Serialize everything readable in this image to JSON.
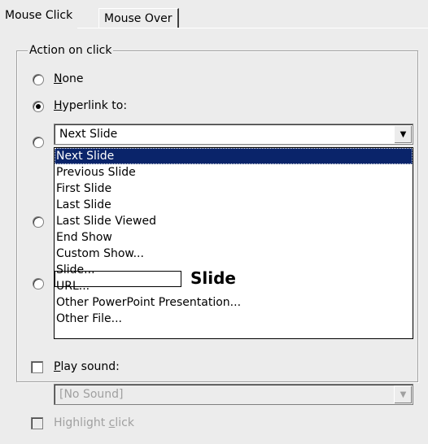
{
  "tabs": [
    {
      "label": "Mouse Click",
      "active": true
    },
    {
      "label": "Mouse Over",
      "active": false
    }
  ],
  "action_group": {
    "title": "Action on click",
    "options": {
      "none": {
        "label": "None",
        "mnemonic": "N",
        "selected": false
      },
      "hyperlink": {
        "label": "Hyperlink to:",
        "mnemonic": "H",
        "selected": true
      }
    },
    "hyperlink_value": "Next Slide"
  },
  "dropdown": {
    "items": [
      "Next Slide",
      "Previous Slide",
      "First Slide",
      "Last Slide",
      "Last Slide Viewed",
      "End Show",
      "Custom Show...",
      "Slide...",
      "URL...",
      "Other PowerPoint Presentation...",
      "Other File..."
    ],
    "selected_index": 0
  },
  "annotation": {
    "label": "Slide"
  },
  "sound": {
    "label": "Play sound:",
    "mnemonic": "P",
    "checked": false,
    "value": "[No Sound]"
  },
  "highlight": {
    "label": "Highlight click",
    "mnemonic": "c",
    "checked": false,
    "enabled": false
  },
  "icons": {
    "dropdown_arrow": "chevron-down-icon"
  }
}
